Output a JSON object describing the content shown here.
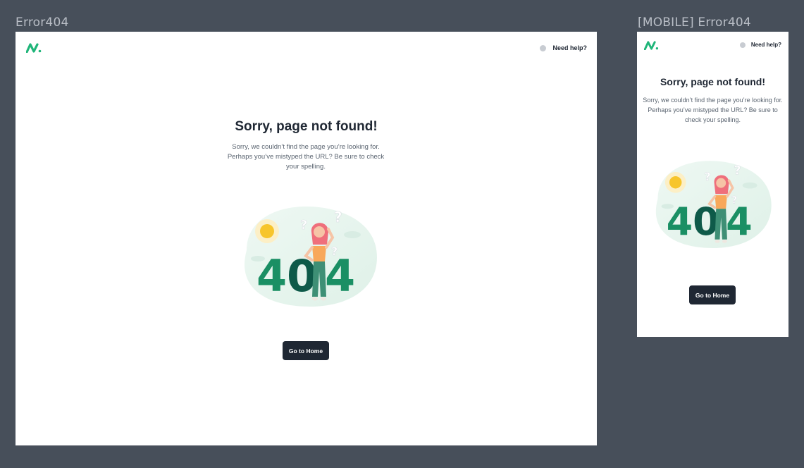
{
  "frames": {
    "desktop_label": "Error404",
    "mobile_label": "[MOBILE] Error404"
  },
  "header": {
    "help_label": "Need help?"
  },
  "content": {
    "title": "Sorry, page not found!",
    "description": "Sorry, we couldn’t find the page you’re looking for. Perhaps you’ve mistyped the URL? Be sure to check your spelling.",
    "illustration_digits": [
      "4",
      "0",
      "4"
    ],
    "home_button": "Go to Home"
  },
  "colors": {
    "canvas": "#474f5a",
    "brand_green": "#1fb579",
    "digit_green": "#1a8f64",
    "dark": "#1f2733",
    "sun": "#f7c52c"
  },
  "icons": [
    "logo-icon",
    "gear-icon",
    "404-illustration"
  ]
}
